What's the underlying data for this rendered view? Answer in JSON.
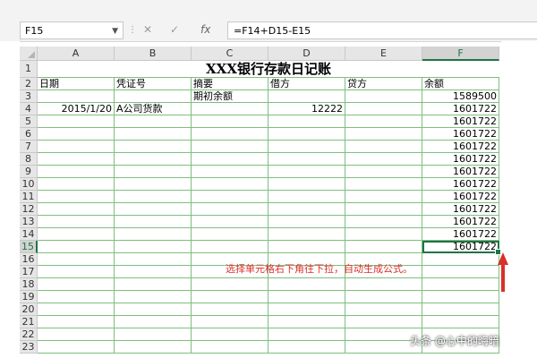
{
  "formula_bar": {
    "name_box": "F15",
    "cancel_glyph": "✕",
    "enter_glyph": "✓",
    "fx_label": "fx",
    "formula": "=F14+D15-E15"
  },
  "sheet": {
    "columns": [
      "A",
      "B",
      "C",
      "D",
      "E",
      "F"
    ],
    "rows": [
      "1",
      "2",
      "3",
      "4",
      "5",
      "6",
      "7",
      "8",
      "9",
      "10",
      "11",
      "12",
      "13",
      "14",
      "15",
      "16",
      "17",
      "18",
      "19",
      "20",
      "21",
      "22",
      "23"
    ],
    "selected_column": "F",
    "selected_row": "15",
    "title": "XXX银行存款日记账",
    "headers": [
      "日期",
      "凭证号",
      "摘要",
      "借方",
      "贷方",
      "余额"
    ],
    "row3": {
      "summary": "期初余额",
      "balance": "1589500"
    },
    "row4": {
      "date": "2015/1/20",
      "voucher": "A公司货款",
      "debit": "12222",
      "balance": "1601722"
    },
    "balances_5_15": [
      "1601722",
      "1601722",
      "1601722",
      "1601722",
      "1601722",
      "1601722",
      "1601722",
      "1601722",
      "1601722",
      "1601722",
      "1601722"
    ]
  },
  "annotation": "选择单元格右下角往下拉，自动生成公式。",
  "watermark": "头条 @心中的晦暗",
  "colors": {
    "accent": "#217346",
    "grid": "#7fbf7f",
    "annotation": "#d9302a"
  }
}
